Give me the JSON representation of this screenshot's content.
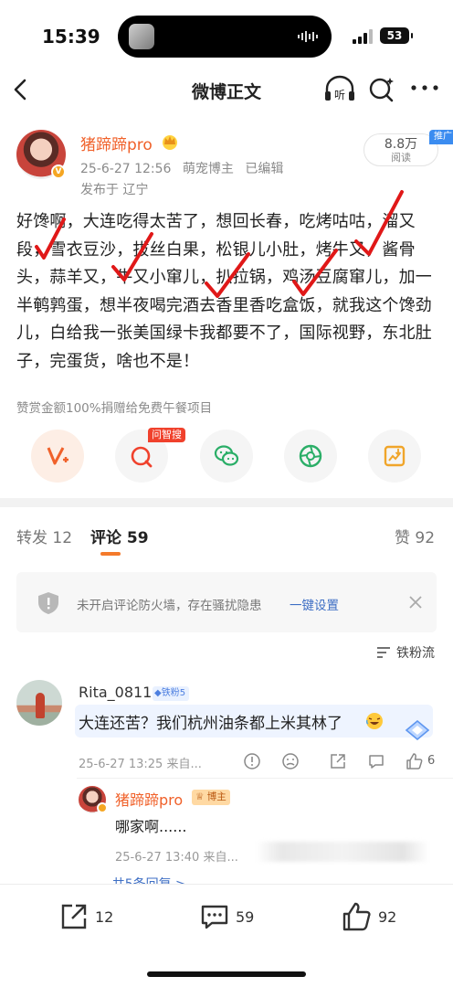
{
  "status_bar": {
    "time": "15:39",
    "battery": "53"
  },
  "nav": {
    "title": "微博正文",
    "listen_label": "听"
  },
  "post": {
    "author": "猪蹄蹄pro",
    "date": "25-6-27 12:56",
    "category": "萌宠博主",
    "edited": "已编辑",
    "location": "发布于 辽宁",
    "reads_count": "8.8万",
    "reads_label": "阅读",
    "promo_tag": "推广",
    "text": "好馋啊，大连吃得太苦了，想回长春，吃烤咕咕，溜又段，雪衣豆沙，拔丝白果，松银儿小肚，烤牛又，酱骨头，蒜羊又，牛又小窜儿，扒拉锅，鸡汤豆腐窜儿，加一半鹌鹑蛋，想半夜喝完酒去香里香吃盒饭，就我这个馋劲儿，白给我一张美国绿卡我都要不了，国际视野，东北肚子，完蛋货，啥也不是！",
    "donate_note": "赞赏金额100%捐赠给免费午餐项目",
    "ask_tag": "问智搜"
  },
  "tabs": {
    "repost_label": "转发",
    "repost_count": "12",
    "comment_label": "评论",
    "comment_count": "59",
    "like_label": "赞",
    "like_count": "92"
  },
  "firewall": {
    "message": "未开启评论防火墙，存在骚扰隐患",
    "link": "一键设置"
  },
  "sort_label": "铁粉流",
  "comment": {
    "user": "Rita_0811",
    "badge": "铁粉5",
    "text": "大连还苦？我们杭州油条都上米其林了",
    "meta": "25-6-27 13:25  来自...",
    "likes": "6"
  },
  "reply": {
    "user": "猪蹄蹄pro",
    "badge": "博主",
    "text": "哪家啊......",
    "meta": "25-6-27 13:40  来自...",
    "more": "共5条回复 >"
  },
  "bottom_bar": {
    "repost": "12",
    "comment": "59",
    "like": "92"
  },
  "colors": {
    "accent": "#f0612a",
    "check_mark": "#e01818",
    "link": "#3d6ec4"
  }
}
